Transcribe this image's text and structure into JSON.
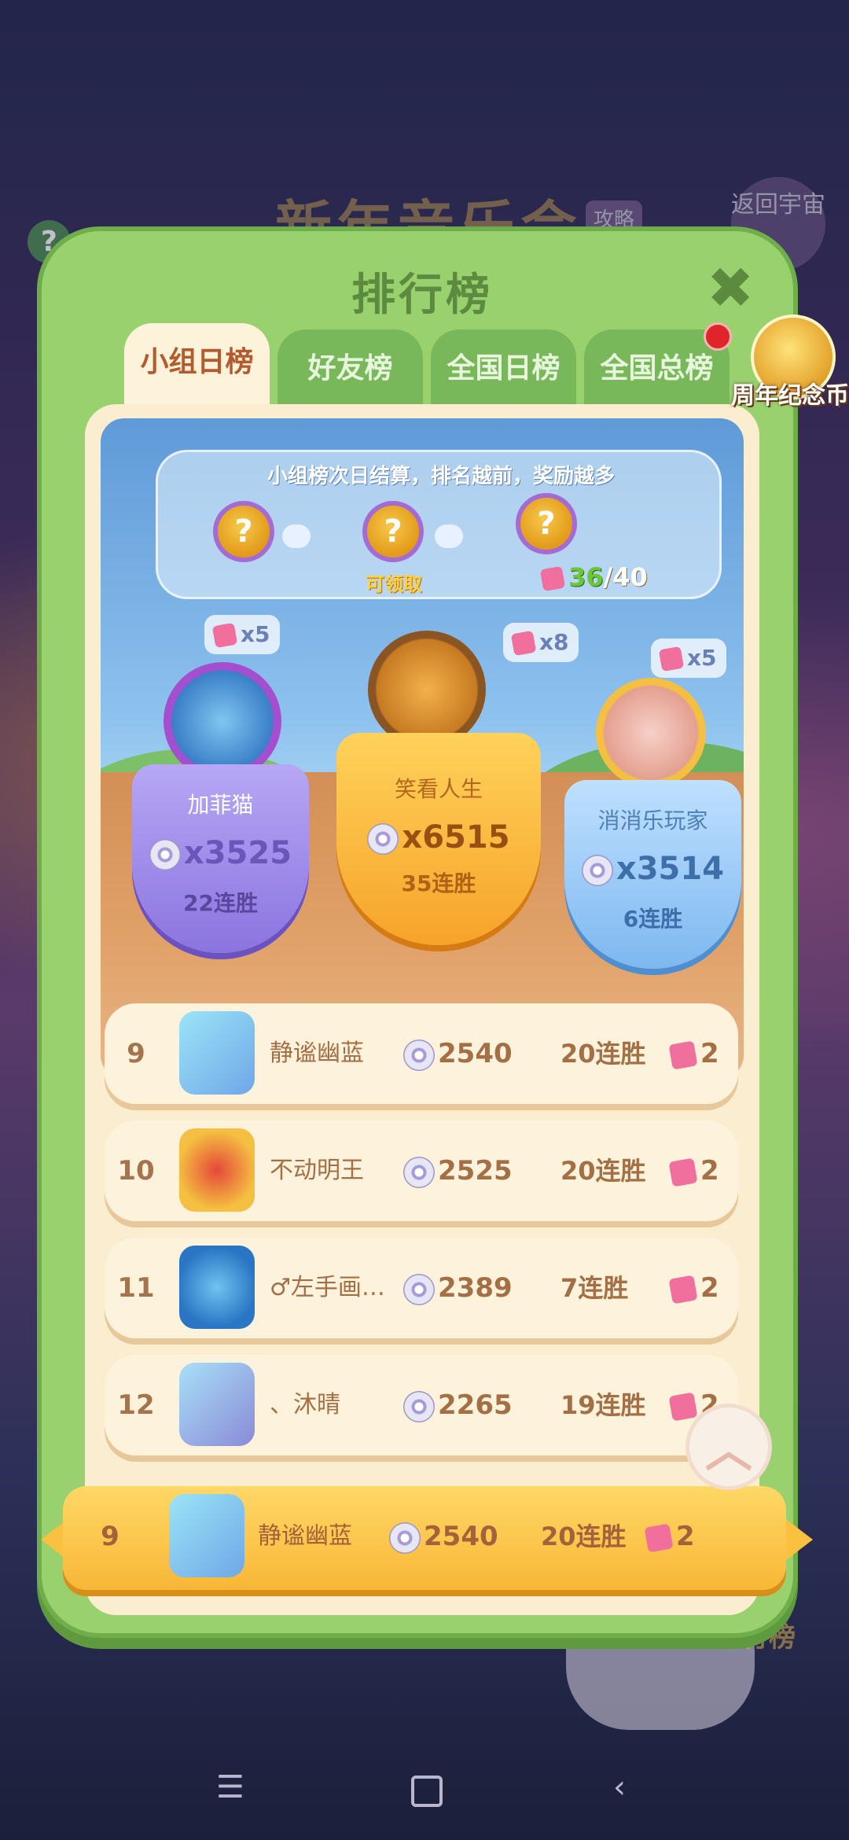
{
  "background": {
    "event_title": "新年音乐会",
    "guide_label": "攻略",
    "back_label": "返回宇宙",
    "help_icon": "?",
    "bottom_rank_label": "排行榜"
  },
  "header": {
    "title": "排行榜",
    "close_icon": "✖"
  },
  "tabs": [
    {
      "label": "小组日榜",
      "active": true
    },
    {
      "label": "好友榜",
      "active": false
    },
    {
      "label": "全国日榜",
      "active": false
    },
    {
      "label": "全国总榜",
      "active": false
    }
  ],
  "anniversary": {
    "label": "周年纪念币"
  },
  "reward_track": {
    "tip": "小组榜次日结算，排名越前，奖励越多",
    "claimable_label": "可领取",
    "progress_current": "36",
    "progress_total": "/40",
    "medal_glyph": "?"
  },
  "podium": [
    {
      "place": 2,
      "name": "加菲猫",
      "score": "x3525",
      "streak": "22连胜",
      "gift": "x5",
      "theme": "#8b74e0"
    },
    {
      "place": 1,
      "name": "笑看人生",
      "score": "x6515",
      "streak": "35连胜",
      "gift": "x8",
      "theme": "#f7a32a"
    },
    {
      "place": 3,
      "name": "消消乐玩家",
      "score": "x3514",
      "streak": "6连胜",
      "gift": "x5",
      "theme": "#7db8f0"
    }
  ],
  "rows": [
    {
      "rank": "9",
      "name": "静谧幽蓝",
      "score": "2540",
      "streak": "20连胜",
      "gift": "2"
    },
    {
      "rank": "10",
      "name": "不动明王",
      "score": "2525",
      "streak": "20连胜",
      "gift": "2"
    },
    {
      "rank": "11",
      "name": "♂左手画…",
      "score": "2389",
      "streak": "7连胜",
      "gift": "2"
    },
    {
      "rank": "12",
      "name": "、沐晴",
      "score": "2265",
      "streak": "19连胜",
      "gift": "2"
    }
  ],
  "my_row": {
    "rank": "9",
    "name": "静谧幽蓝",
    "score": "2540",
    "streak": "20连胜",
    "gift": "2"
  },
  "scroll_top_icon": "︿",
  "nav": {
    "menu": "☰",
    "back": "‹"
  },
  "colors": {
    "panel_green": "#9ad16f",
    "tab_active": "#fdf3da",
    "accent_brown": "#a46f45",
    "my_row_gold": "#ffd866"
  }
}
